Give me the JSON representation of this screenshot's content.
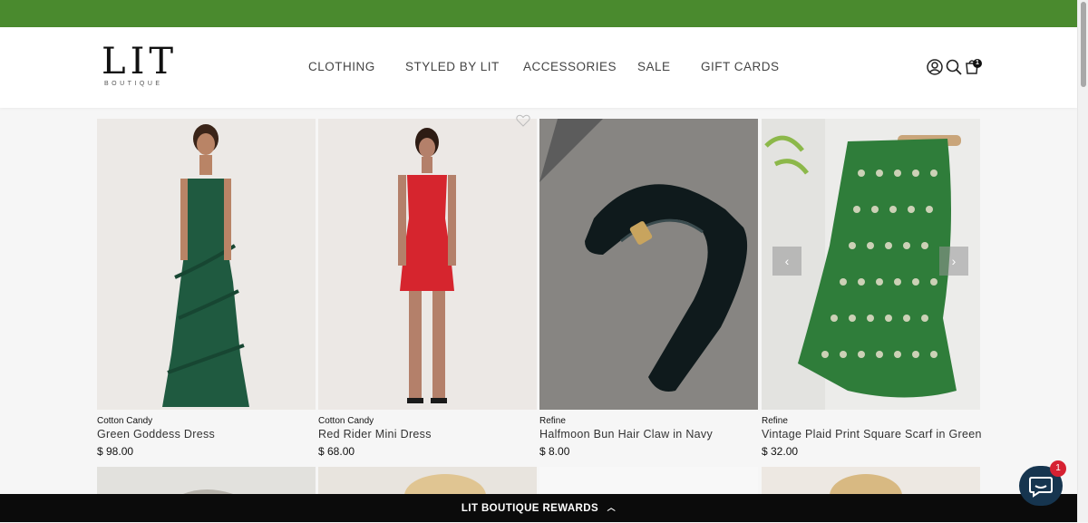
{
  "colors": {
    "announcement_bar": "#4a8a2e",
    "rewards_bar": "#0b0b0b",
    "chat_bubble": "#16354f",
    "chat_badge": "#d62132"
  },
  "brand": {
    "name": "LIT",
    "tagline": "BOUTIQUE"
  },
  "nav": {
    "items": [
      "CLOTHING",
      "STYLED BY LIT",
      "ACCESSORIES",
      "SALE",
      "GIFT CARDS"
    ]
  },
  "header_icons": [
    "account-icon",
    "search-icon",
    "cart-icon"
  ],
  "cart": {
    "count": "1"
  },
  "products": [
    {
      "vendor": "Cotton Candy",
      "title": "Green Goddess Dress",
      "price": "$ 98.00"
    },
    {
      "vendor": "Cotton Candy",
      "title": "Red Rider Mini Dress",
      "price": "$ 68.00"
    },
    {
      "vendor": "Refine",
      "title": "Halfmoon Bun Hair Claw in Navy",
      "price": "$ 8.00"
    },
    {
      "vendor": "Refine",
      "title": "Vintage Plaid Print Square Scarf in Green",
      "price": "$ 32.00"
    }
  ],
  "carousel": {
    "prev_icon": "‹",
    "next_icon": "›"
  },
  "rewards": {
    "label": "LIT BOUTIQUE REWARDS"
  },
  "chat": {
    "badge": "1"
  }
}
